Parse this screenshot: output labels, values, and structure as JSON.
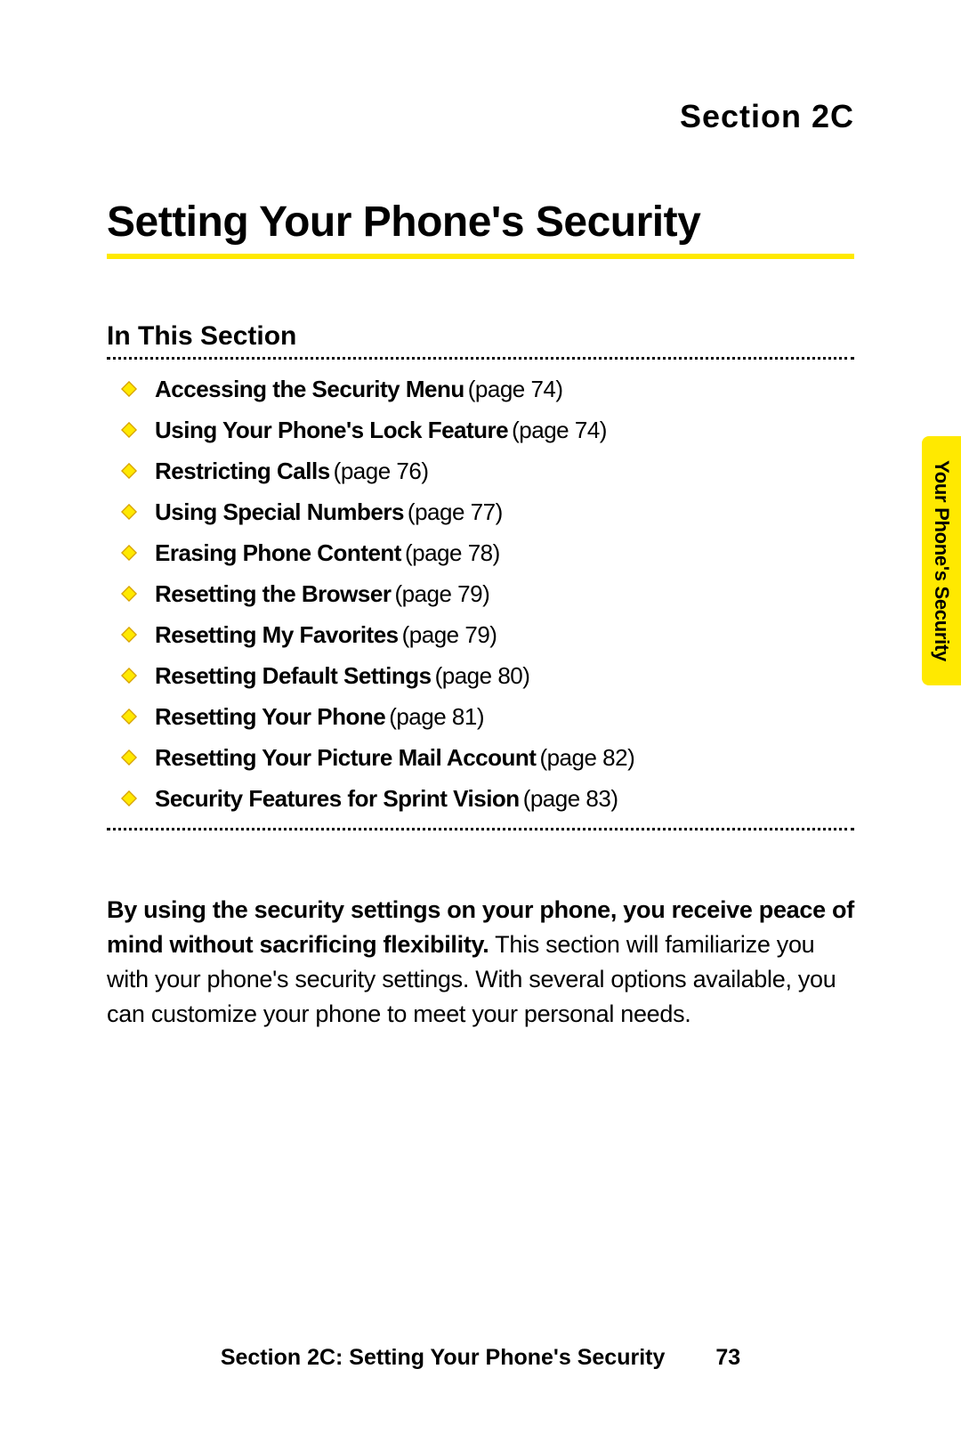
{
  "section_label": "Section 2C",
  "page_title": "Setting Your Phone's Security",
  "subheading": "In This Section",
  "toc": [
    {
      "title": "Accessing the Security Menu",
      "page": "(page 74)"
    },
    {
      "title": "Using Your Phone's Lock Feature",
      "page": "(page 74)"
    },
    {
      "title": "Restricting Calls",
      "page": "(page 76)"
    },
    {
      "title": "Using Special Numbers",
      "page": "(page 77)"
    },
    {
      "title": "Erasing Phone Content",
      "page": "(page 78)"
    },
    {
      "title": "Resetting the Browser",
      "page": "(page 79)"
    },
    {
      "title": "Resetting My Favorites",
      "page": "(page 79)"
    },
    {
      "title": "Resetting Default Settings",
      "page": "(page 80)"
    },
    {
      "title": "Resetting Your Phone",
      "page": "(page 81)"
    },
    {
      "title": "Resetting Your Picture Mail Account",
      "page": "(page 82)"
    },
    {
      "title": "Security Features for Sprint Vision",
      "page": "(page 83)"
    }
  ],
  "body": {
    "lead": "By using the security settings on your phone, you receive peace of mind without sacrificing flexibility.",
    "rest": " This section will familiarize you with your phone's security settings. With several options available, you can customize your phone to meet your personal needs."
  },
  "side_tab": "Your Phone's Security",
  "footer": {
    "title": "Section 2C: Setting Your Phone's Security",
    "page_num": "73"
  },
  "colors": {
    "accent": "#ffe900",
    "bullet_fill": "#ffe900",
    "bullet_stroke": "#d8a300"
  }
}
